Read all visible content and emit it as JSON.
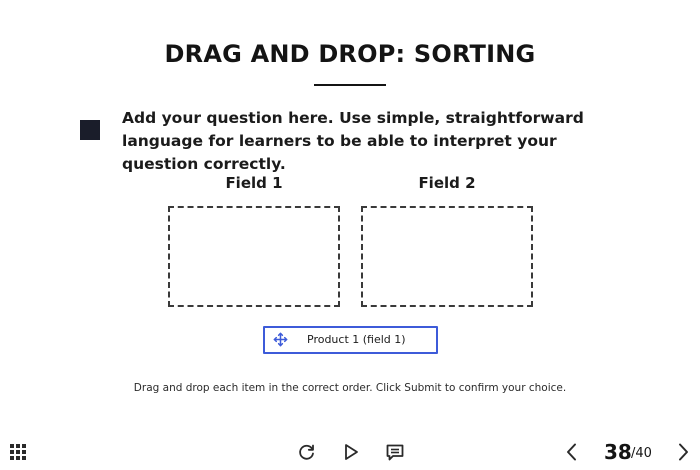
{
  "slide": {
    "title": "DRAG AND DROP: SORTING",
    "question": "Add your question here. Use simple, straightforward language for learners to be able to interpret your question correctly.",
    "fields": [
      {
        "label": "Field 1"
      },
      {
        "label": "Field 2"
      }
    ],
    "draggable_items": [
      {
        "label": "Product 1 (field 1)",
        "icon": "drag-move-icon"
      }
    ],
    "instruction": "Drag and drop each item in the correct order. Click Submit to confirm your choice."
  },
  "player": {
    "menu_icon": "grid-menu-icon",
    "controls": [
      {
        "name": "replay",
        "icon": "replay-icon"
      },
      {
        "name": "play",
        "icon": "play-icon"
      },
      {
        "name": "notes",
        "icon": "notes-icon"
      }
    ],
    "pagination": {
      "current": "38",
      "total": "/40",
      "prev_icon": "chevron-left-icon",
      "next_icon": "chevron-right-icon"
    }
  },
  "colors": {
    "title": "#141414",
    "marker": "#1a1d2a",
    "item_border": "#3d5bd9",
    "drop_zone_border": "#3a3a3a"
  }
}
